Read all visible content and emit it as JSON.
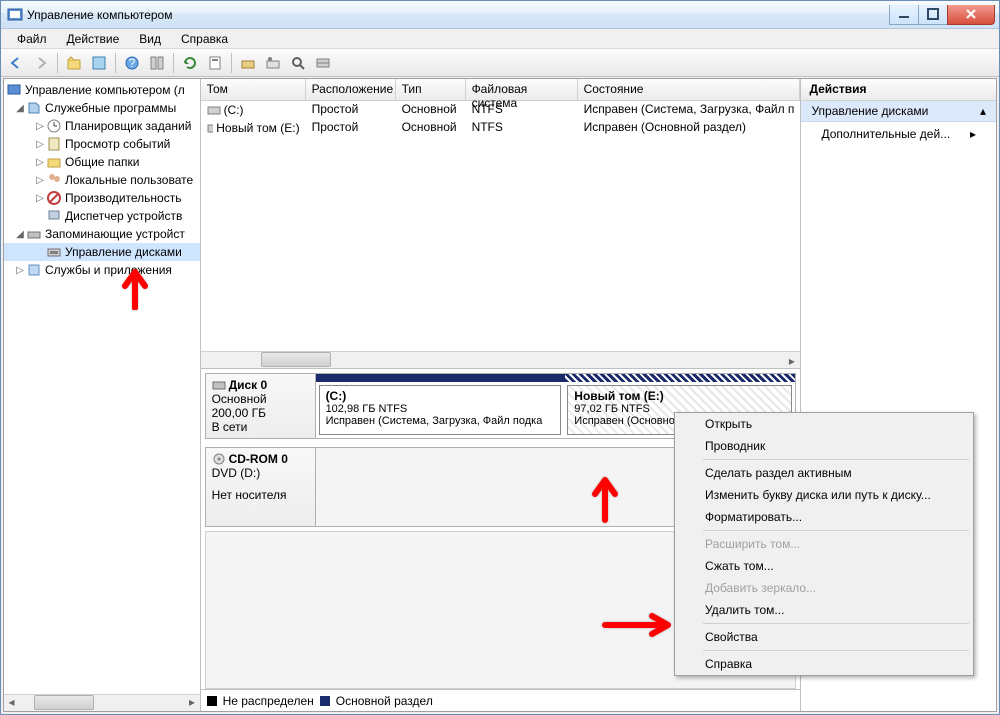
{
  "window": {
    "title": "Управление компьютером"
  },
  "menu": {
    "file": "Файл",
    "action": "Действие",
    "view": "Вид",
    "help": "Справка"
  },
  "tree": {
    "root": "Управление компьютером (л",
    "group1": "Служебные программы",
    "g1_items": [
      "Планировщик заданий",
      "Просмотр событий",
      "Общие папки",
      "Локальные пользовате",
      "Производительность",
      "Диспетчер устройств"
    ],
    "group2": "Запоминающие устройст",
    "g2_item": "Управление дисками",
    "group3": "Службы и приложения"
  },
  "list": {
    "headers": {
      "vol": "Том",
      "layout": "Расположение",
      "type": "Тип",
      "fs": "Файловая система",
      "state": "Состояние"
    },
    "rows": [
      {
        "vol": "(C:)",
        "layout": "Простой",
        "type": "Основной",
        "fs": "NTFS",
        "state": "Исправен (Система, Загрузка, Файл п"
      },
      {
        "vol": "Новый том (E:)",
        "layout": "Простой",
        "type": "Основной",
        "fs": "NTFS",
        "state": "Исправен (Основной раздел)"
      }
    ]
  },
  "disks": {
    "d0": {
      "name": "Диск 0",
      "type": "Основной",
      "size": "200,00 ГБ",
      "status": "В сети",
      "v1": {
        "name": "(C:)",
        "size": "102,98 ГБ NTFS",
        "state": "Исправен (Система, Загрузка, Файл подка"
      },
      "v2": {
        "name": "Новый том  (E:)",
        "size": "97,02 ГБ NTFS",
        "state": "Исправен (Основной"
      }
    },
    "cd": {
      "name": "CD-ROM 0",
      "type": "DVD (D:)",
      "status": "Нет носителя"
    }
  },
  "legend": {
    "unalloc": "Не распределен",
    "primary": "Основной раздел"
  },
  "actions": {
    "title": "Действия",
    "section": "Управление дисками",
    "more": "Дополнительные дей..."
  },
  "ctx": {
    "open": "Открыть",
    "explorer": "Проводник",
    "active": "Сделать раздел активным",
    "change": "Изменить букву диска или путь к диску...",
    "format": "Форматировать...",
    "extend": "Расширить том...",
    "shrink": "Сжать том...",
    "mirror": "Добавить зеркало...",
    "delete": "Удалить том...",
    "props": "Свойства",
    "help": "Справка"
  }
}
